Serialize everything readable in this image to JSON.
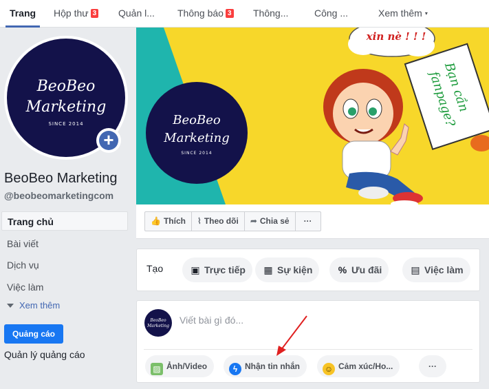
{
  "tabs": [
    {
      "label": "Trang",
      "active": true
    },
    {
      "label": "Hộp thư",
      "badge": "3"
    },
    {
      "label": "Quản l..."
    },
    {
      "label": "Thông báo",
      "badge": "3"
    },
    {
      "label": "Thông..."
    },
    {
      "label": "Công ..."
    },
    {
      "label": "Xem thêm",
      "caret": "▾"
    }
  ],
  "profile": {
    "logo_line1": "BeoBeo",
    "logo_line2": "Marketing",
    "logo_since": "SINCE 2014",
    "name": "BeoBeo Marketing",
    "handle": "@beobeomarketingcom"
  },
  "sidebar": {
    "items": [
      {
        "label": "Trang chủ",
        "active": true
      },
      {
        "label": "Bài viết"
      },
      {
        "label": "Dịch vụ"
      },
      {
        "label": "Việc làm"
      }
    ],
    "see_more": "Xem thêm",
    "ad_button": "Quảng cáo",
    "ad_manage": "Quản lý quảng cáo"
  },
  "cover": {
    "speech": "xin nè ! ! !",
    "sign_line1": "Bạn cần",
    "sign_line2": "fanpage?"
  },
  "actions": {
    "like": "Thích",
    "follow": "Theo dõi",
    "share": "Chia sẻ",
    "more": "···"
  },
  "create": {
    "label": "Tạo",
    "items": [
      "Trực tiếp",
      "Sự kiện",
      "Ưu đãi",
      "Việc làm"
    ]
  },
  "composer": {
    "placeholder": "Viết bài gì đó...",
    "buttons": [
      "Ảnh/Video",
      "Nhận tin nhắn",
      "Cảm xúc/Ho..."
    ],
    "more": "···"
  },
  "colors": {
    "brand_blue": "#4267b2",
    "ad_blue": "#1877f2",
    "badge_red": "#fa3e3e",
    "cover_yellow": "#f7d72a",
    "cover_teal": "#1fb5ad",
    "logo_navy": "#13124a"
  }
}
